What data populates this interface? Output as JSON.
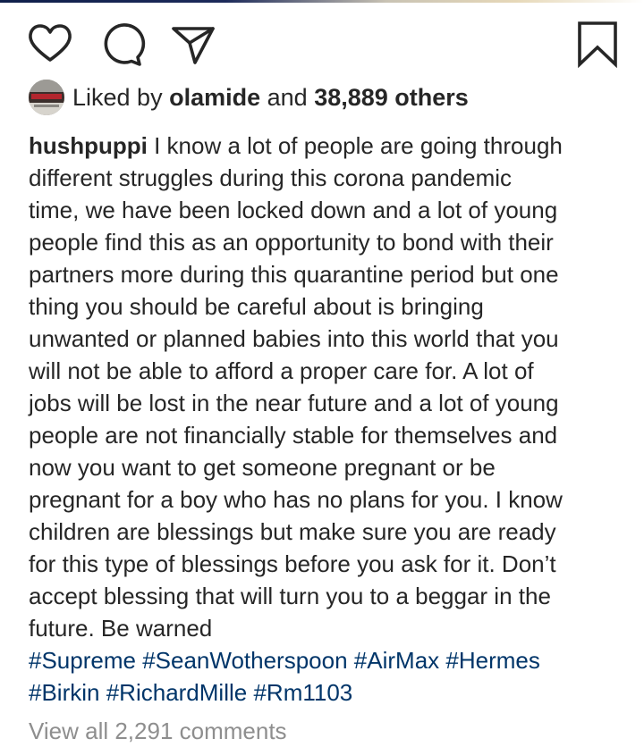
{
  "likes": {
    "prefix": "Liked by",
    "user": "olamide",
    "joiner": "and",
    "others": "38,889 others"
  },
  "post": {
    "username": "hushpuppi",
    "caption_lines": [
      "I know a lot of people are going through",
      "different struggles during this corona pandemic",
      "time, we have been locked down and a lot of young",
      "people find this as an opportunity to bond with their",
      "partners more during this quarantine period but one",
      "thing you should be careful about is bringing",
      "unwanted or planned babies into this world that you",
      "will not be able to afford a proper care for. A lot of",
      "jobs will be lost in the near future and a lot of young",
      "people are not financially stable for themselves and",
      "now you want to get someone pregnant or be",
      "pregnant for a boy who has no plans for you. I know",
      "children are blessings but make sure you are ready",
      "for this type of blessings before you ask for it. Don’t",
      "accept blessing that will turn you to a beggar in the",
      "future. Be warned"
    ],
    "hashtags_line1": [
      "#Supreme",
      "#SeanWotherspoon",
      "#AirMax",
      "#Hermes"
    ],
    "hashtags_line2": [
      "#Birkin",
      "#RichardMille",
      "#Rm1103"
    ]
  },
  "comments": {
    "view_all": "View all 2,291 comments"
  },
  "icons": {
    "like": "heart-icon",
    "comment": "comment-bubble-icon",
    "share": "paper-plane-icon",
    "save": "bookmark-icon"
  },
  "colors": {
    "text": "#262626",
    "hashtag": "#003569",
    "muted": "#8e8e8e"
  }
}
